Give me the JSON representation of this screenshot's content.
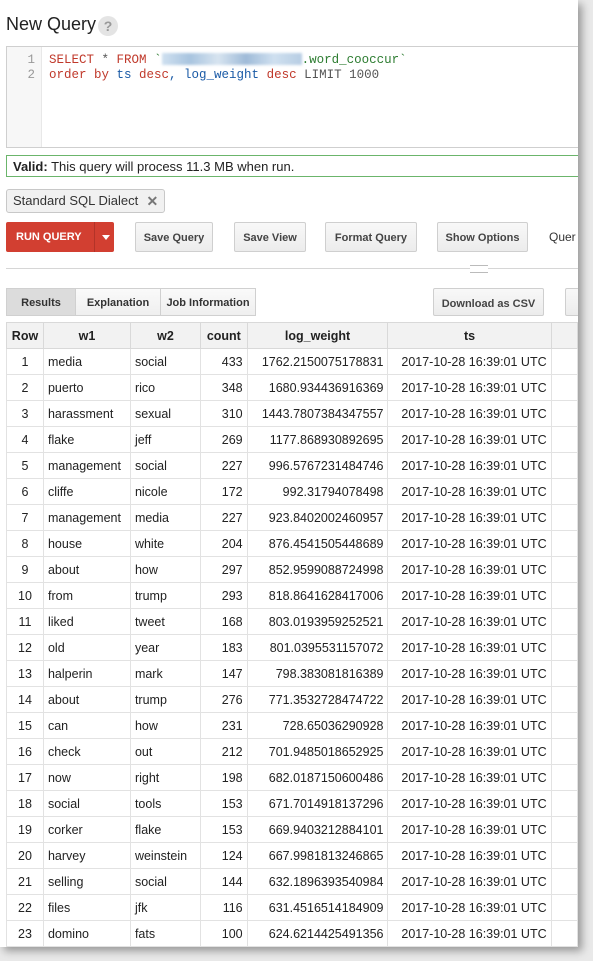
{
  "header": {
    "title": "New Query",
    "help_icon": "?"
  },
  "editor": {
    "line_numbers": [
      "1",
      "2"
    ],
    "line1": {
      "kw1": "SELECT",
      "star": " * ",
      "kw2": "FROM",
      "table_ref": ".word_cooccur"
    },
    "line2": {
      "kw1": "order by",
      "rest1": " ts ",
      "kw2": "desc",
      "rest2": ", log_weight ",
      "kw3": "desc",
      "rest3": " LIMIT 1000"
    }
  },
  "validation": {
    "label": "Valid:",
    "message": " This query will process 11.3 MB when run.",
    "color": "#6bb56b"
  },
  "dialect_chip": {
    "label": "Standard SQL Dialect",
    "close": "✕"
  },
  "toolbar": {
    "run_label": "RUN QUERY",
    "run_color": "#d23f31",
    "save_query": "Save Query",
    "save_view": "Save View",
    "format_query": "Format Query",
    "show_options": "Show Options",
    "overflow_label": "Quer"
  },
  "results_tabs": [
    "Results",
    "Explanation",
    "Job Information"
  ],
  "download_csv": "Download as CSV",
  "table": {
    "columns": [
      "Row",
      "w1",
      "w2",
      "count",
      "log_weight",
      "ts"
    ],
    "rows": [
      [
        "1",
        "media",
        "social",
        "433",
        "1762.2150075178831",
        "2017-10-28 16:39:01 UTC"
      ],
      [
        "2",
        "puerto",
        "rico",
        "348",
        "1680.934436916369",
        "2017-10-28 16:39:01 UTC"
      ],
      [
        "3",
        "harassment",
        "sexual",
        "310",
        "1443.7807384347557",
        "2017-10-28 16:39:01 UTC"
      ],
      [
        "4",
        "flake",
        "jeff",
        "269",
        "1177.868930892695",
        "2017-10-28 16:39:01 UTC"
      ],
      [
        "5",
        "management",
        "social",
        "227",
        "996.5767231484746",
        "2017-10-28 16:39:01 UTC"
      ],
      [
        "6",
        "cliffe",
        "nicole",
        "172",
        "992.31794078498",
        "2017-10-28 16:39:01 UTC"
      ],
      [
        "7",
        "management",
        "media",
        "227",
        "923.8402002460957",
        "2017-10-28 16:39:01 UTC"
      ],
      [
        "8",
        "house",
        "white",
        "204",
        "876.4541505448689",
        "2017-10-28 16:39:01 UTC"
      ],
      [
        "9",
        "about",
        "how",
        "297",
        "852.9599088724998",
        "2017-10-28 16:39:01 UTC"
      ],
      [
        "10",
        "from",
        "trump",
        "293",
        "818.8641628417006",
        "2017-10-28 16:39:01 UTC"
      ],
      [
        "11",
        "liked",
        "tweet",
        "168",
        "803.0193959252521",
        "2017-10-28 16:39:01 UTC"
      ],
      [
        "12",
        "old",
        "year",
        "183",
        "801.0395531157072",
        "2017-10-28 16:39:01 UTC"
      ],
      [
        "13",
        "halperin",
        "mark",
        "147",
        "798.383081816389",
        "2017-10-28 16:39:01 UTC"
      ],
      [
        "14",
        "about",
        "trump",
        "276",
        "771.3532728474722",
        "2017-10-28 16:39:01 UTC"
      ],
      [
        "15",
        "can",
        "how",
        "231",
        "728.65036290928",
        "2017-10-28 16:39:01 UTC"
      ],
      [
        "16",
        "check",
        "out",
        "212",
        "701.9485018652925",
        "2017-10-28 16:39:01 UTC"
      ],
      [
        "17",
        "now",
        "right",
        "198",
        "682.0187150600486",
        "2017-10-28 16:39:01 UTC"
      ],
      [
        "18",
        "social",
        "tools",
        "153",
        "671.7014918137296",
        "2017-10-28 16:39:01 UTC"
      ],
      [
        "19",
        "corker",
        "flake",
        "153",
        "669.9403212884101",
        "2017-10-28 16:39:01 UTC"
      ],
      [
        "20",
        "harvey",
        "weinstein",
        "124",
        "667.9981813246865",
        "2017-10-28 16:39:01 UTC"
      ],
      [
        "21",
        "selling",
        "social",
        "144",
        "632.1896393540984",
        "2017-10-28 16:39:01 UTC"
      ],
      [
        "22",
        "files",
        "jfk",
        "116",
        "631.4516514184909",
        "2017-10-28 16:39:01 UTC"
      ],
      [
        "23",
        "domino",
        "fats",
        "100",
        "624.6214425491356",
        "2017-10-28 16:39:01 UTC"
      ]
    ]
  }
}
